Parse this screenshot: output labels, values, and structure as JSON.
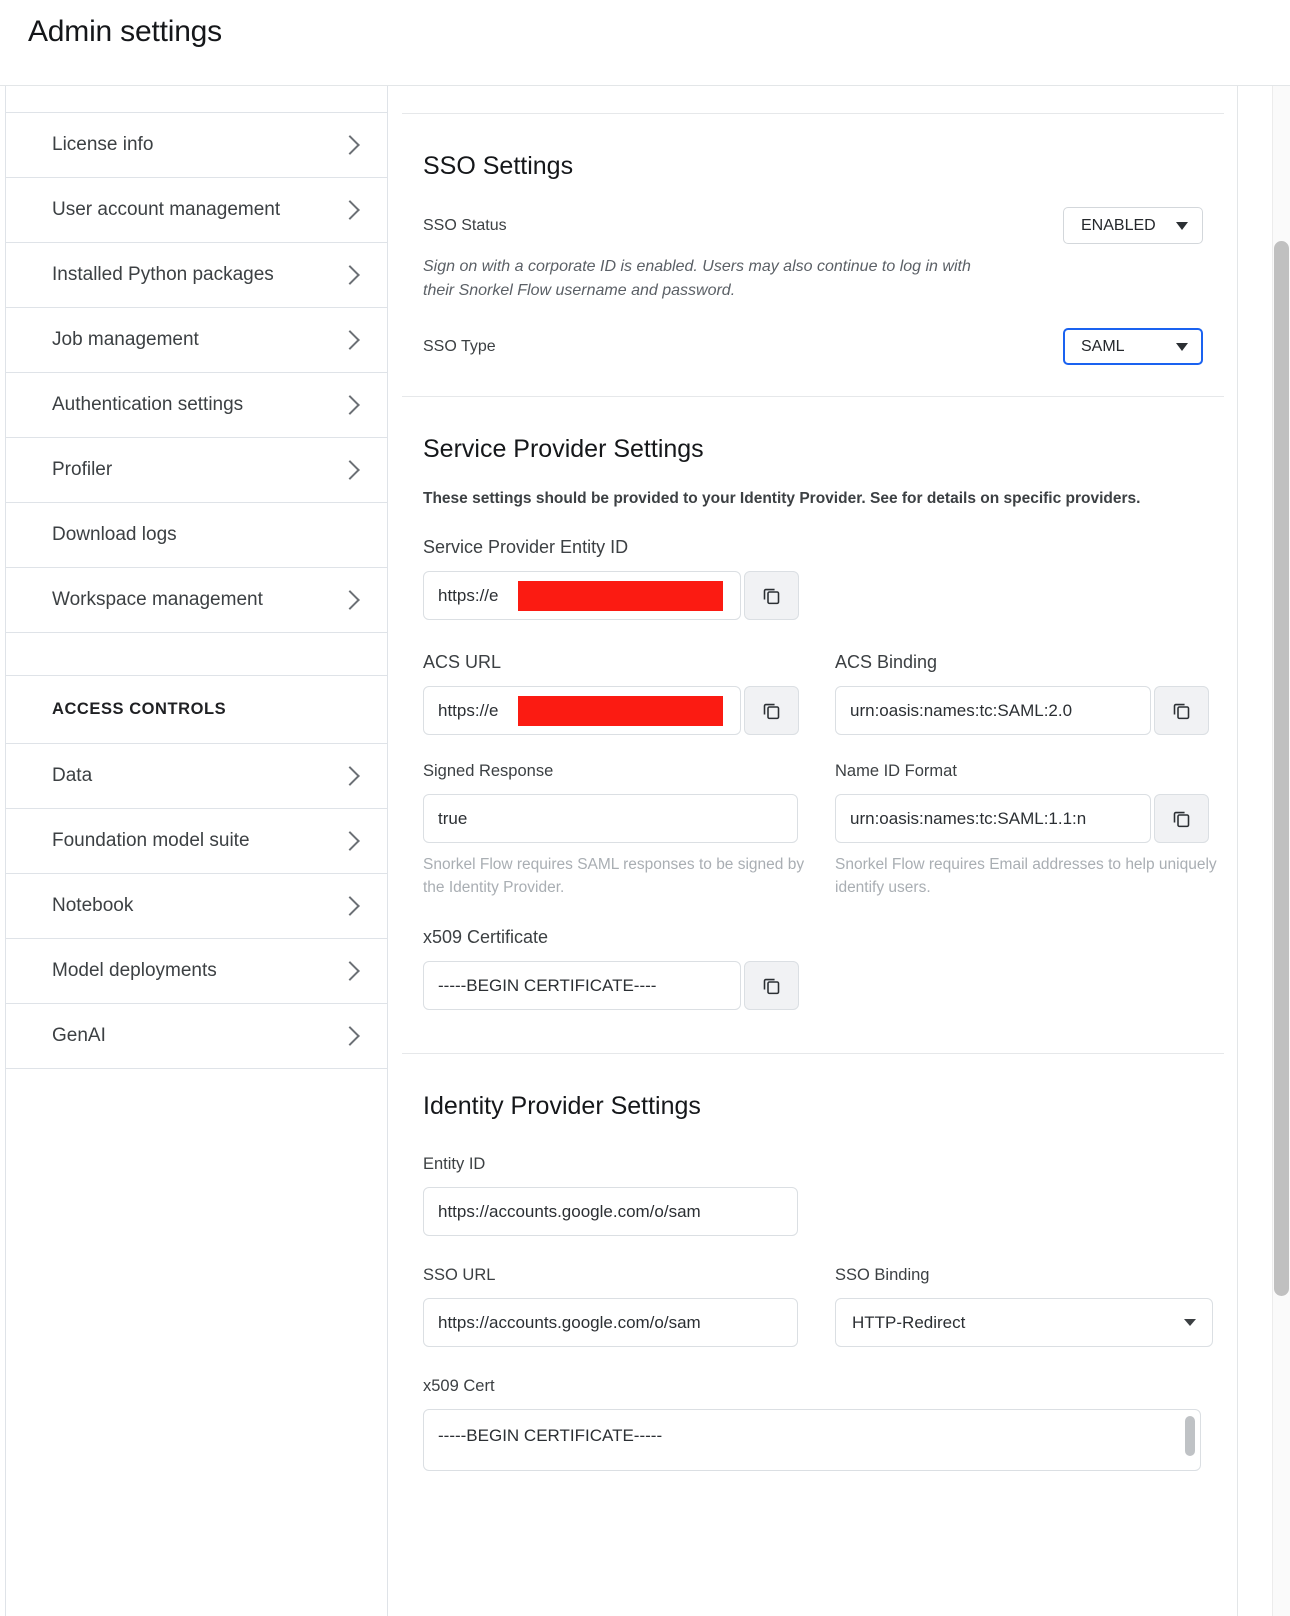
{
  "header": {
    "title": "Admin settings"
  },
  "sidebar": {
    "items": [
      {
        "label": "License info",
        "chevron": true
      },
      {
        "label": "User account management",
        "chevron": true
      },
      {
        "label": "Installed Python packages",
        "chevron": true
      },
      {
        "label": "Job management",
        "chevron": true
      },
      {
        "label": "Authentication settings",
        "chevron": true
      },
      {
        "label": "Profiler",
        "chevron": true
      },
      {
        "label": "Download logs",
        "chevron": false
      },
      {
        "label": "Workspace management",
        "chevron": true
      }
    ],
    "section_label": "ACCESS CONTROLS",
    "access_items": [
      {
        "label": "Data",
        "chevron": true
      },
      {
        "label": "Foundation model suite",
        "chevron": true
      },
      {
        "label": "Notebook",
        "chevron": true
      },
      {
        "label": "Model deployments",
        "chevron": true
      },
      {
        "label": "GenAI",
        "chevron": true
      }
    ]
  },
  "sso": {
    "title": "SSO Settings",
    "status_label": "SSO Status",
    "status_value": "ENABLED",
    "status_note": "Sign on with a corporate ID is enabled. Users may also continue to log in with their Snorkel Flow username and password.",
    "type_label": "SSO Type",
    "type_value": "SAML"
  },
  "service_provider": {
    "title": "Service Provider Settings",
    "note": "These settings should be provided to your Identity Provider. See for details on specific providers.",
    "entity_id_label": "Service Provider Entity ID",
    "entity_id_value": "https://e",
    "acs_url_label": "ACS URL",
    "acs_url_value": "https://e",
    "acs_binding_label": "ACS Binding",
    "acs_binding_value": "urn:oasis:names:tc:SAML:2.0",
    "signed_response_label": "Signed Response",
    "signed_response_value": "true",
    "signed_response_hint": "Snorkel Flow requires SAML responses to be signed by the Identity Provider.",
    "name_id_label": "Name ID Format",
    "name_id_value": "urn:oasis:names:tc:SAML:1.1:n",
    "name_id_hint": "Snorkel Flow requires Email addresses to help uniquely identify users.",
    "x509_label": "x509 Certificate",
    "x509_value": "-----BEGIN CERTIFICATE----"
  },
  "identity_provider": {
    "title": "Identity Provider Settings",
    "entity_id_label": "Entity ID",
    "entity_id_value": "https://accounts.google.com/o/sam",
    "sso_url_label": "SSO URL",
    "sso_url_value": "https://accounts.google.com/o/sam",
    "sso_binding_label": "SSO Binding",
    "sso_binding_value": "HTTP-Redirect",
    "x509_label": "x509 Cert",
    "x509_value": "-----BEGIN CERTIFICATE-----"
  },
  "icons": {
    "copy": "copy-icon",
    "chevron_right": "chevron-right-icon",
    "caret_down": "chevron-down-icon"
  },
  "colors": {
    "focus_blue": "#1a62f0",
    "redaction_red": "#fb1b12",
    "border": "#dbdfe3"
  }
}
